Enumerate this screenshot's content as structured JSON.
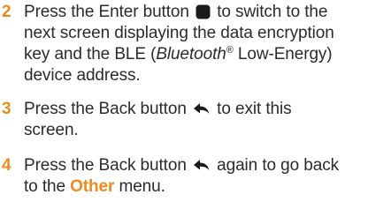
{
  "steps": [
    {
      "number": "2",
      "line1_before_icon": "Press the Enter button",
      "line1_icon": "enter-square-icon",
      "line1_after_icon": "to switch to the",
      "line2": "next screen displaying the data encryption",
      "line3_before": "key and the BLE (",
      "line3_italic": "Bluetooth",
      "line3_sup": "®",
      "line3_after": " Low-Energy)",
      "line4": "device address."
    },
    {
      "number": "3",
      "line1_before_icon": "Press the Back button",
      "line1_icon": "back-arrow-icon",
      "line1_after_icon": "to exit this",
      "line2": "screen."
    },
    {
      "number": "4",
      "line1_before_icon": "Press the Back button",
      "line1_icon": "back-arrow-icon",
      "line1_after_icon": "again to go back",
      "line2_before": "to the ",
      "line2_highlight": "Other",
      "line2_after": " menu."
    }
  ],
  "colors": {
    "step_number": "#f08a1c",
    "body_text": "#2b2b2b",
    "highlight": "#f08a1c"
  }
}
